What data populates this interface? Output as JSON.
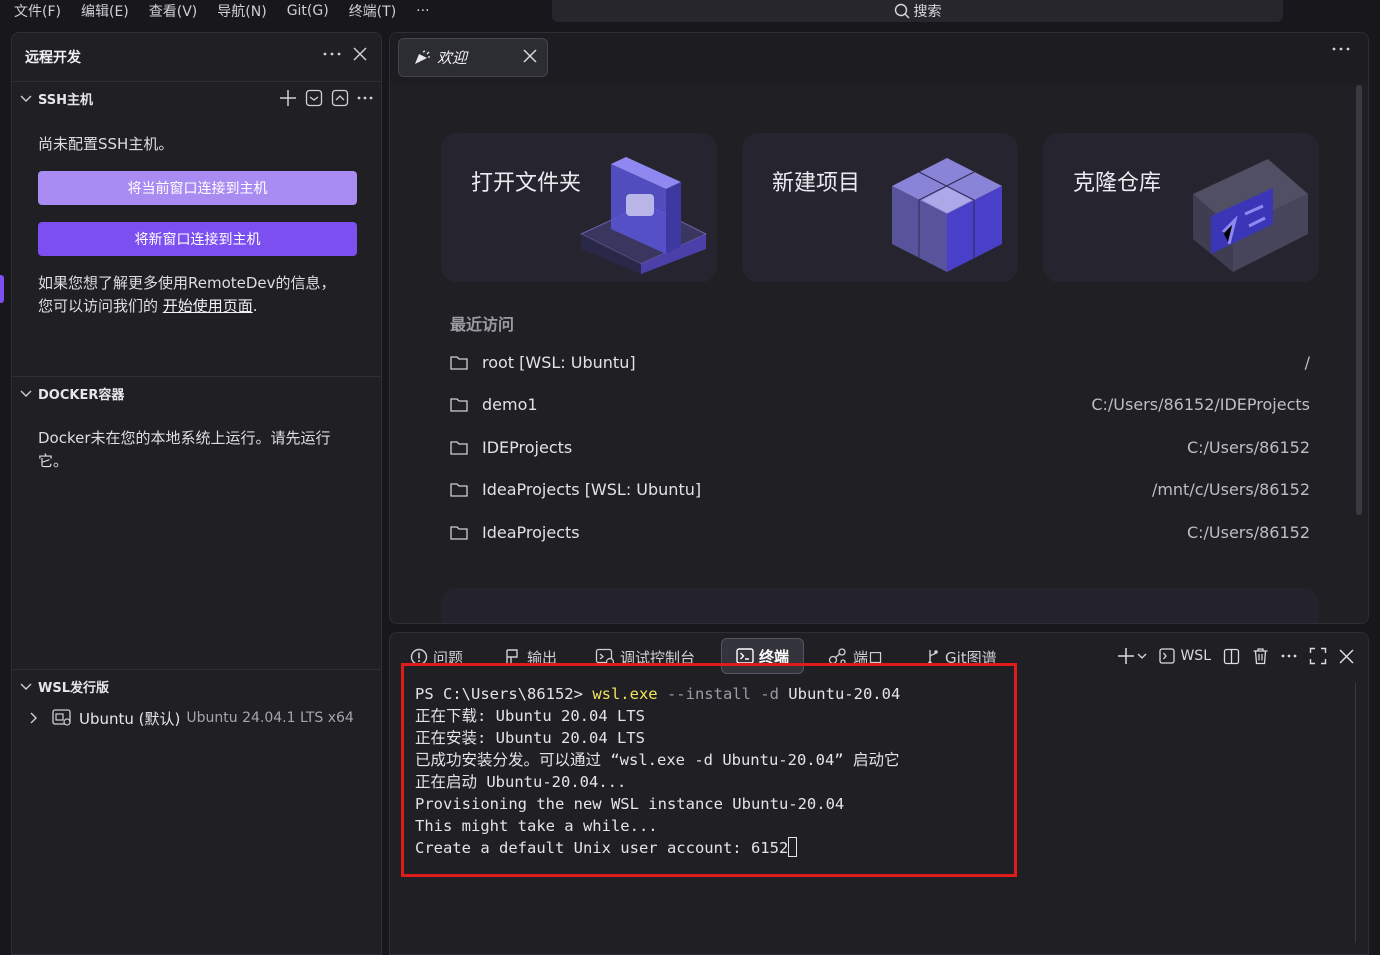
{
  "menu": {
    "items": [
      "文件(F)",
      "编辑(E)",
      "查看(V)",
      "导航(N)",
      "Git(G)",
      "终端(T)",
      "···"
    ],
    "search_label": "搜索"
  },
  "left_panel": {
    "title": "远程开发",
    "ssh": {
      "title": "SSH主机",
      "empty_text": "尚未配置SSH主机。",
      "btn_connect_current": "将当前窗口连接到主机",
      "btn_connect_new": "将新窗口连接到主机",
      "info_line1": "如果您想了解更多使用RemoteDev的信息，",
      "info_line2_prefix": "您可以访问我们的 ",
      "info_link": "开始使用页面",
      "info_suffix": "."
    },
    "docker": {
      "title": "DOCKER容器",
      "text_line1": "Docker未在您的本地系统上运行。请先运行",
      "text_line2": "它。"
    },
    "wsl": {
      "title": "WSL发行版",
      "distro_name": "Ubuntu (默认)",
      "distro_detail": "Ubuntu 24.04.1 LTS x64"
    }
  },
  "editor": {
    "tab_label": "欢迎",
    "cards": [
      "打开文件夹",
      "新建项目",
      "克隆仓库"
    ],
    "recent_title": "最近访问",
    "recent": [
      {
        "name": "root [WSL: Ubuntu]",
        "path": "/"
      },
      {
        "name": "demo1",
        "path": "C:/Users/86152/IDEProjects"
      },
      {
        "name": "IDEProjects",
        "path": "C:/Users/86152"
      },
      {
        "name": "IdeaProjects [WSL: Ubuntu]",
        "path": "/mnt/c/Users/86152"
      },
      {
        "name": "IdeaProjects",
        "path": "C:/Users/86152"
      }
    ]
  },
  "terminal": {
    "tabs": [
      "问题",
      "输出",
      "调试控制台",
      "终端",
      "端口",
      "Git图谱"
    ],
    "active_tab": "终端",
    "shell_label": "WSL",
    "prompt": "PS C:\\Users\\86152> ",
    "command": "wsl.exe",
    "args": " --install -d ",
    "target": "Ubuntu-20.04",
    "lines": [
      "正在下载: Ubuntu 20.04 LTS",
      "正在安装: Ubuntu 20.04 LTS",
      "已成功安装分发。可以通过 “wsl.exe -d Ubuntu-20.04” 启动它",
      "正在启动 Ubuntu-20.04...",
      "Provisioning the new WSL instance Ubuntu-20.04",
      "This might take a while..."
    ],
    "last_line": "Create a default Unix user account: 6152"
  },
  "colors": {
    "accent": "#7c4ff0",
    "accent_light": "#a98cf2",
    "highlight_box": "#e01b1b",
    "command_yellow": "#f2e35c"
  }
}
